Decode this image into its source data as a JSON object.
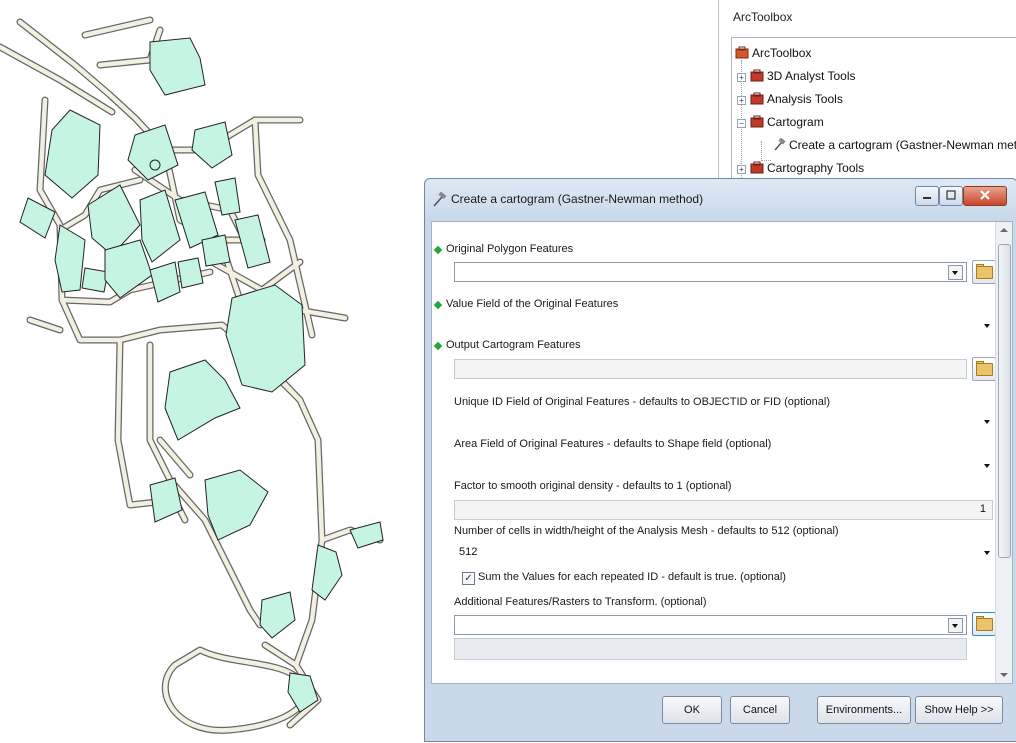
{
  "toolbox": {
    "title": "ArcToolbox",
    "root": "ArcToolbox",
    "items": [
      {
        "label": "3D Analyst Tools"
      },
      {
        "label": "Analysis Tools"
      },
      {
        "label": "Cartogram"
      },
      {
        "label": "Create a cartogram (Gastner-Newman met"
      },
      {
        "label": "Cartography Tools"
      }
    ]
  },
  "dialog": {
    "title": "Create a cartogram (Gastner-Newman method)",
    "params": {
      "original_polygon": {
        "label": "Original Polygon Features",
        "value": ""
      },
      "value_field": {
        "label": "Value Field of the Original Features",
        "value": ""
      },
      "output_cartogram": {
        "label": "Output Cartogram Features",
        "value": ""
      },
      "unique_id": {
        "label": "Unique ID Field of Original Features - defaults to OBJECTID or FID (optional)",
        "value": ""
      },
      "area_field": {
        "label": "Area Field of Original Features - defaults to Shape field (optional)",
        "value": ""
      },
      "smooth_factor": {
        "label": "Factor to smooth original density - defaults to 1 (optional)",
        "value": "1"
      },
      "mesh_cells": {
        "label": "Number of cells in width/height of the Analysis Mesh - defaults to 512 (optional)",
        "value": "512"
      },
      "sum_values": {
        "label": "Sum the Values for each repeated ID - default is true. (optional)",
        "checked": true
      },
      "additional_features": {
        "label": "Additional Features/Rasters to Transform. (optional)",
        "value": ""
      }
    },
    "buttons": {
      "ok": "OK",
      "cancel": "Cancel",
      "environments": "Environments...",
      "show_help": "Show Help >>"
    }
  },
  "colors": {
    "building_fill": "#c5f5e2",
    "road_fill": "#f2f0e1",
    "required_marker": "#22a63a",
    "dialog_frame": "#c9d9ea"
  }
}
